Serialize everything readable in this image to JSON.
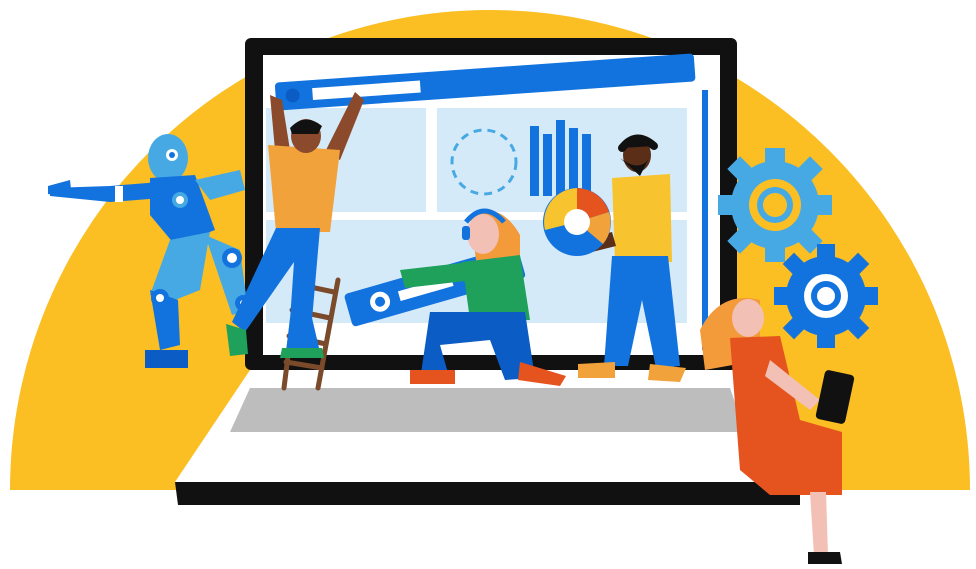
{
  "scene": {
    "subject": "",
    "colors": {
      "sun": "#FBBF24",
      "brand_blue": "#1273DE",
      "dark_blue": "#0B5CC4",
      "panel_light": "#D5EAF8",
      "screen_bezel": "#111111",
      "keyboard_gray": "#BDBDBD",
      "gear_blue": "#47A9E3",
      "orange_shirt": "#F2A23A",
      "green_shirt": "#1FA05B",
      "yellow_shirt": "#F7C32E",
      "red_dress": "#E5531E",
      "skin_dark": "#8B4A2B",
      "skin_light": "#F3C0B5",
      "hair_ginger": "#F39A3B",
      "ladder_brown": "#7A4A2A"
    },
    "icons": [
      "robot-icon",
      "gear-icon",
      "ladder-icon",
      "tablet-icon",
      "bar-chart-icon",
      "donut-chart-icon",
      "headset-icon"
    ]
  }
}
